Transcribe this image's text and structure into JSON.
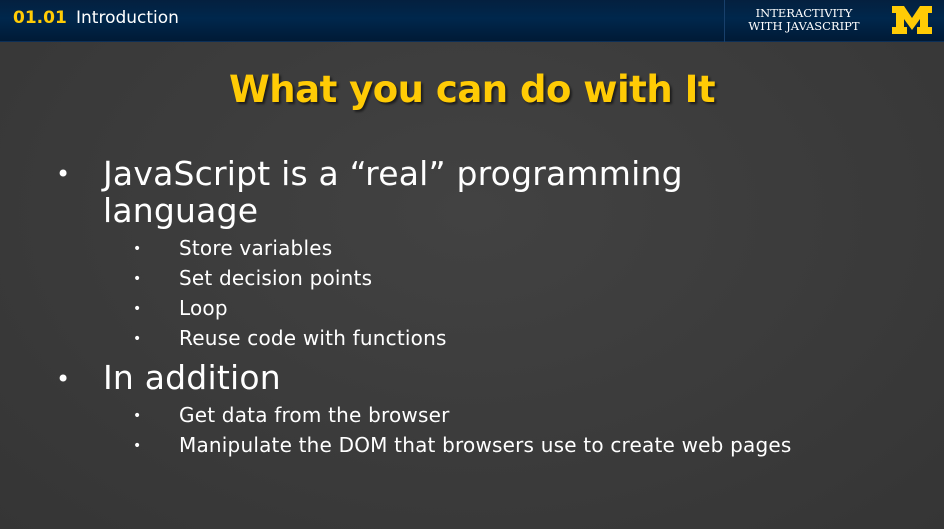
{
  "header": {
    "lesson_number": "01.01",
    "lesson_title": "Introduction",
    "course_line1": "Interactivity",
    "course_line2": "with JavaScript",
    "logo_letter": "M"
  },
  "slide": {
    "title": "What you can do with It",
    "bullet_symbol": "•",
    "bullets": [
      {
        "text_line1": "JavaScript is a “real” programming",
        "text_line2": "language",
        "subitems": [
          "Store variables",
          "Set decision points",
          "Loop",
          "Reuse code with functions"
        ]
      },
      {
        "text_line1": "In addition",
        "subitems": [
          "Get data from the browser",
          "Manipulate the DOM that browsers use to create web pages"
        ]
      }
    ]
  },
  "colors": {
    "header_bg": "#00274c",
    "accent_maize": "#ffcb05",
    "slide_bg": "#3d3d3d",
    "text": "#ffffff"
  }
}
